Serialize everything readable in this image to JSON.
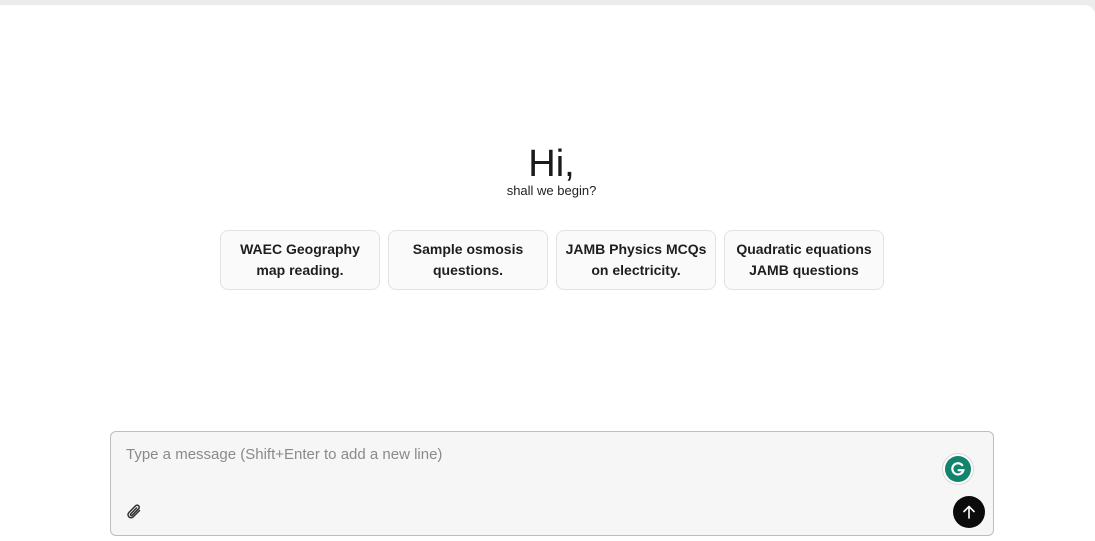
{
  "hero": {
    "title": "Hi,",
    "subtitle": "shall we begin?"
  },
  "suggestions": [
    {
      "line1": "WAEC Geography",
      "line2": "map reading."
    },
    {
      "line1": "Sample osmosis",
      "line2": "questions."
    },
    {
      "line1": "JAMB Physics MCQs",
      "line2": "on electricity."
    },
    {
      "line1": "Quadratic equations",
      "line2": "JAMB questions"
    }
  ],
  "composer": {
    "placeholder": "Type a message (Shift+Enter to add a new line)",
    "value": "",
    "attach_icon": "paperclip-icon",
    "grammarly_icon": "grammarly-icon",
    "send_icon": "arrow-up-icon"
  },
  "colors": {
    "grammarly": "#12846d",
    "send_button": "#0b0b0b",
    "composer_bg": "#f6f6f6",
    "chip_bg": "#fafafa"
  }
}
